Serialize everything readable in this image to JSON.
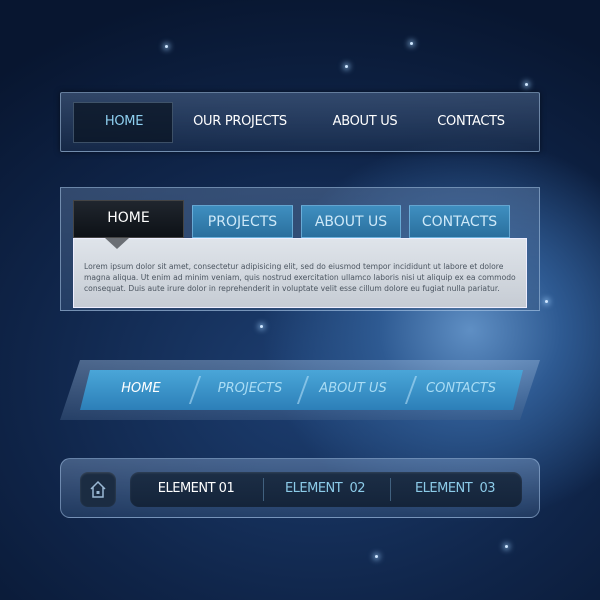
{
  "nav1": {
    "items": [
      {
        "label": "HOME",
        "active": true
      },
      {
        "label": "OUR PROJECTS"
      },
      {
        "label": "ABOUT US"
      },
      {
        "label": "CONTACTS"
      }
    ]
  },
  "nav2": {
    "tabs": [
      {
        "label": "HOME",
        "active": true
      },
      {
        "label": "PROJECTS"
      },
      {
        "label": "ABOUT US"
      },
      {
        "label": "CONTACTS"
      }
    ],
    "content": "Lorem ipsum dolor sit amet, consectetur adipisicing elit, sed do eiusmod tempor incididunt ut labore et dolore magna aliqua. Ut enim ad minim veniam, quis nostrud exercitation ullamco laboris nisi ut aliquip ex ea commodo consequat. Duis aute irure dolor in reprehenderit in voluptate velit esse cillum dolore eu fugiat nulla pariatur."
  },
  "nav3": {
    "items": [
      {
        "label": "HOME",
        "active": true
      },
      {
        "label": "PROJECTS"
      },
      {
        "label": "ABOUT US"
      },
      {
        "label": "CONTACTS"
      }
    ]
  },
  "nav4": {
    "home_icon": "home-icon",
    "items": [
      {
        "label": "ELEMENT 01",
        "active": true
      },
      {
        "label": "ELEMENT  02"
      },
      {
        "label": "ELEMENT  03"
      }
    ]
  },
  "colors": {
    "accent": "#3a94c8",
    "active_text": "#8fd0f0",
    "background": "#0f2448"
  }
}
